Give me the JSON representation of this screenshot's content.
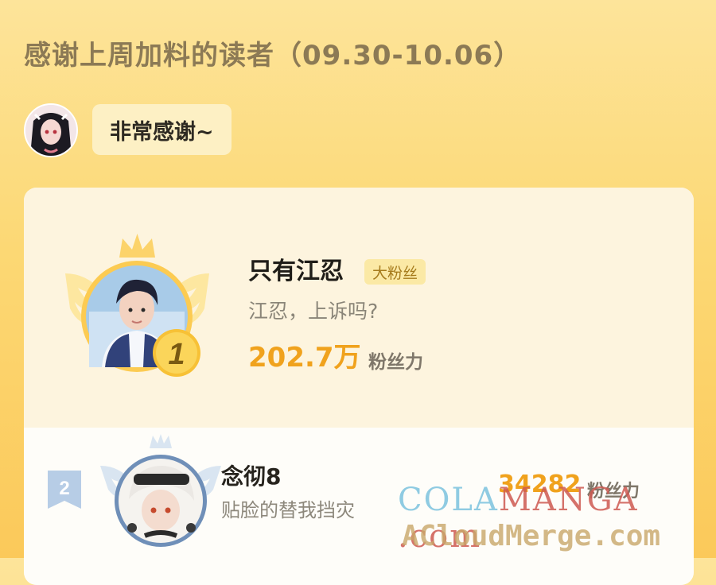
{
  "header": {
    "title": "感谢上周加料的读者（09.30-10.06）"
  },
  "message": {
    "text": "非常感谢~"
  },
  "ranking": [
    {
      "rank": "1",
      "name": "只有江忍",
      "tag": "大粉丝",
      "comment": "江忍，上诉吗?",
      "score": "202.7万",
      "unit": "粉丝力"
    },
    {
      "rank": "2",
      "name": "念彻8",
      "comment": "贴脸的替我挡灾",
      "score": "34282",
      "unit": "粉丝力"
    }
  ],
  "watermark": {
    "line1_a": "COLA",
    "line1_b": "MANGA",
    "line1_c": " .com",
    "line2": "ACloudMerge.com"
  },
  "colors": {
    "accent_gold": "#f0a21d",
    "bg_top": "#fde49a",
    "bg_bottom": "#fbc95a"
  }
}
